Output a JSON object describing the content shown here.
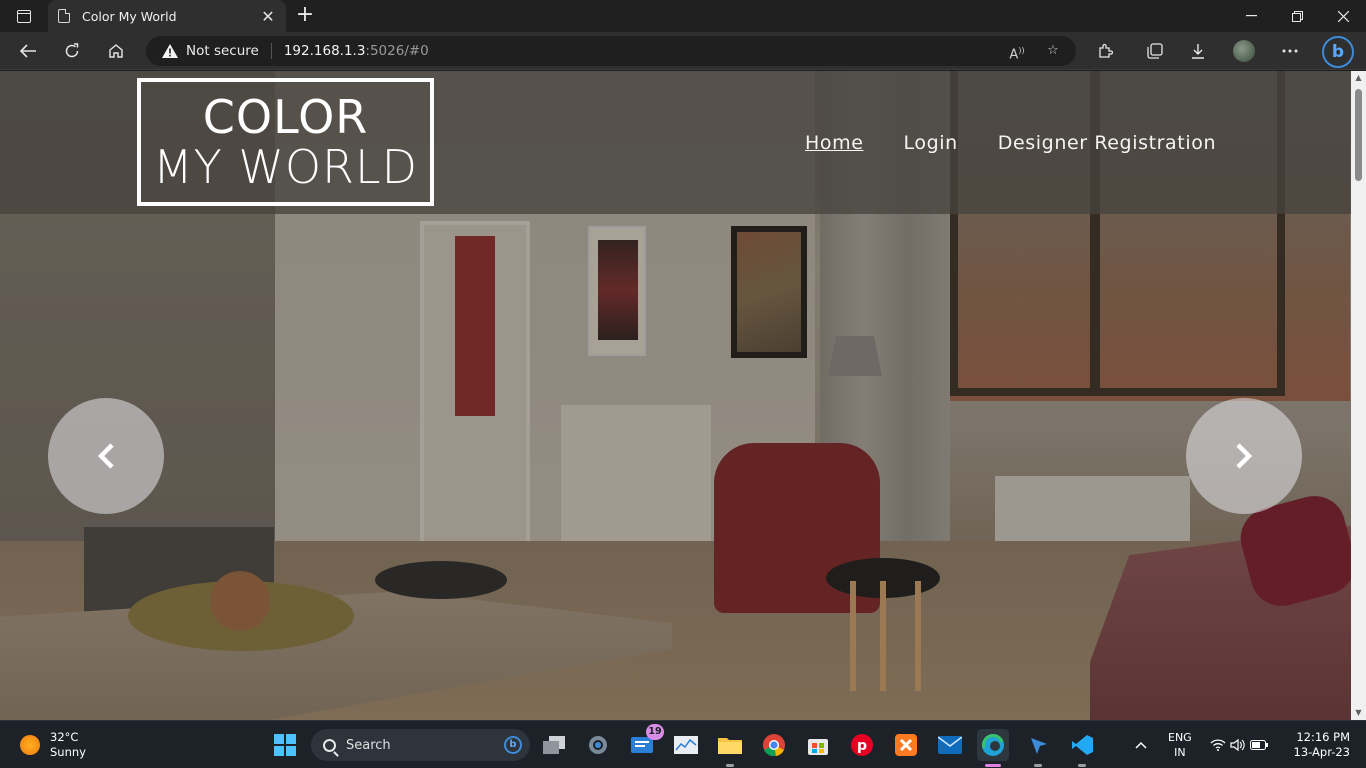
{
  "browser": {
    "tab_title": "Color My World",
    "tab_close": "✕",
    "new_tab": "+",
    "security_label": "Not secure",
    "url_host": "192.168.1.3",
    "url_rest": ":5026/#0"
  },
  "site": {
    "logo_line1": "COLOR",
    "logo_line2": "MY WORLD",
    "nav": [
      {
        "label": "Home",
        "active": true
      },
      {
        "label": "Login",
        "active": false
      },
      {
        "label": "Designer Registration",
        "active": false
      }
    ]
  },
  "carousel": {
    "prev_icon": "chevron-left-icon",
    "next_icon": "chevron-right-icon"
  },
  "taskbar": {
    "weather_temp": "32°C",
    "weather_cond": "Sunny",
    "search_placeholder": "Search",
    "notification_count": "19",
    "lang_line1": "ENG",
    "lang_line2": "IN",
    "time": "12:16 PM",
    "date": "13-Apr-23"
  },
  "colors": {
    "header_overlay": "#46423e",
    "accent_blue": "#3d8bd9",
    "taskbar_bg": "#1c2228"
  }
}
